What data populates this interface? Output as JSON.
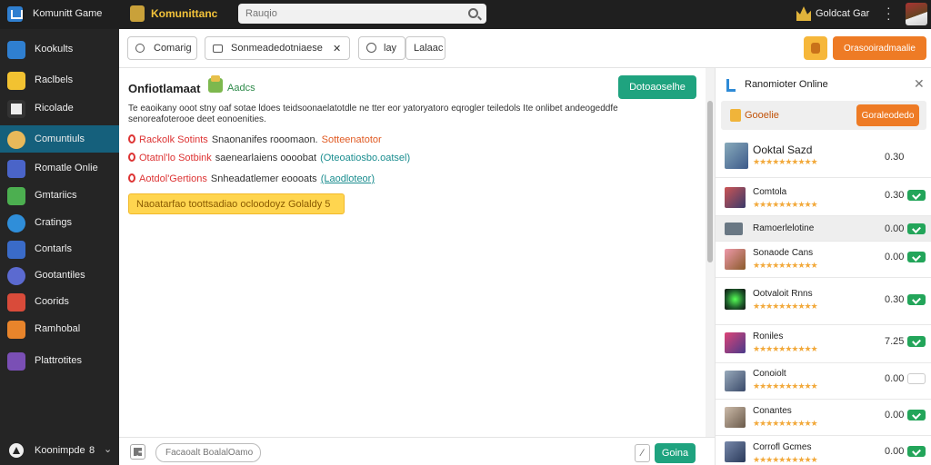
{
  "topbar": {
    "app_title": "Komunitt Game",
    "brand": "Komunittanc",
    "search_placeholder": "Rauqio",
    "user_name": "Goldcat Gar"
  },
  "sidebar": {
    "items": [
      {
        "label": "Kookults",
        "icon": "cube-blue-icon",
        "color": "#2f7fd0",
        "active": false
      },
      {
        "label": "Raclbels",
        "icon": "dice-yellow-icon",
        "color": "#f2c231",
        "active": false
      },
      {
        "label": "Ricolade",
        "icon": "box-icon",
        "color": "#eeeeee",
        "active": false
      },
      {
        "label": "Comuntiuls",
        "icon": "coin-icon",
        "color": "#e9b95a",
        "active": true
      },
      {
        "label": "Romatle Onlie",
        "icon": "grid-icon",
        "color": "#4a64c8",
        "active": false
      },
      {
        "label": "Gmtariics",
        "icon": "puzzle-icon",
        "color": "#4caf50",
        "active": false
      },
      {
        "label": "Cratings",
        "icon": "circle-arrow-icon",
        "color": "#2f8ed9",
        "active": false
      },
      {
        "label": "Contarls",
        "icon": "chart-icon",
        "color": "#3a6bc8",
        "active": false
      },
      {
        "label": "Gootantiles",
        "icon": "people-icon",
        "color": "#5b6ad0",
        "active": false
      },
      {
        "label": "Coorids",
        "icon": "gem-icon",
        "color": "#d94b3a",
        "active": false
      },
      {
        "label": "Ramhobal",
        "icon": "fire-icon",
        "color": "#e8842b",
        "active": false
      },
      {
        "label": "Plattrotites",
        "icon": "sword-icon",
        "color": "#7a4fb5",
        "active": false
      }
    ],
    "footer": {
      "label": "Koonimpde",
      "count": "8"
    }
  },
  "toolbar": {
    "buttons": [
      {
        "label": "Comarig"
      },
      {
        "label": "Sonmeadedotniaese"
      },
      {
        "label": "lay"
      },
      {
        "label": "Lalaac"
      }
    ],
    "close_glyph": "✕",
    "orange_button": "Orasooiradmaalie"
  },
  "main": {
    "title": "Onfiotlamaat",
    "title_tag": "Aadcs",
    "primary_button": "Dotoaoselhe",
    "description": "Te eaoikany ooot stny oaf sotae ldoes teidsoonaelatotdle ne tter eor yatoryatoro eqrogler teiledols Ite onlibet andeogeddfe senoreafoterooe deet eonoenities.",
    "rows": [
      {
        "label": "Rackolk Sotints",
        "text": "Snaonanifes rooomaon.",
        "extra": "Sotteenatotor",
        "extra_style": "orange"
      },
      {
        "label": "Otatnl'lo Sotbink",
        "text": "saenearlaiens oooobat",
        "extra": "(Oteoatiosbo.oatsel)",
        "extra_style": "teal"
      },
      {
        "label": "Aotdol'Gertions",
        "text": "Snheadatlemer eoooats",
        "extra": "(Laodloteor)",
        "extra_style": "link"
      }
    ],
    "alert": "Naoatarfao toottsadiao ocloodoyz Golaldy 5"
  },
  "bottombar": {
    "input_placeholder": "Facaoalt BoalalOamo",
    "small_button": "⁄",
    "send_button": "Goina"
  },
  "right_panel": {
    "title": "Ranomioter Online",
    "banner_label": "Gooelie",
    "banner_button": "Goraleodedo",
    "games": [
      {
        "name": "Ooktal Sazd",
        "stars": "★★★★★★★★★★",
        "price": "0.30",
        "checked": null,
        "thumb": "#3c5a8a"
      },
      {
        "name": "Comtola",
        "stars": "★★★★★★★★★★",
        "price": "0.30",
        "checked": true,
        "thumb": "#6a2a2a"
      },
      {
        "name": "Ramoerlelotine",
        "stars": "",
        "price": "0.00",
        "checked": true,
        "thumb": "#55606a"
      },
      {
        "name": "Sonaode Cans",
        "stars": "★★★★★★★★★★",
        "price": "0.00",
        "checked": true,
        "thumb": "#8a5a2a"
      },
      {
        "name": "Ootvaloit Rnns",
        "stars": "★★★★★★★★★★",
        "price": "0.30",
        "checked": true,
        "thumb": "#1d5a2a"
      },
      {
        "name": "Roniles",
        "stars": "★★★★★★★★★★",
        "price": "7.25",
        "checked": true,
        "thumb": "#4a3a8a"
      },
      {
        "name": "Conoiolt",
        "stars": "★★★★★★★★★★",
        "price": "0.00",
        "checked": false,
        "thumb": "#3a4a6a"
      },
      {
        "name": "Conantes",
        "stars": "★★★★★★★★★★",
        "price": "0.00",
        "checked": true,
        "thumb": "#6a5a4a"
      },
      {
        "name": "Corrofl Gcmes",
        "stars": "★★★★★★★★★★",
        "price": "0.00",
        "checked": true,
        "thumb": "#2a3a5a"
      }
    ]
  }
}
